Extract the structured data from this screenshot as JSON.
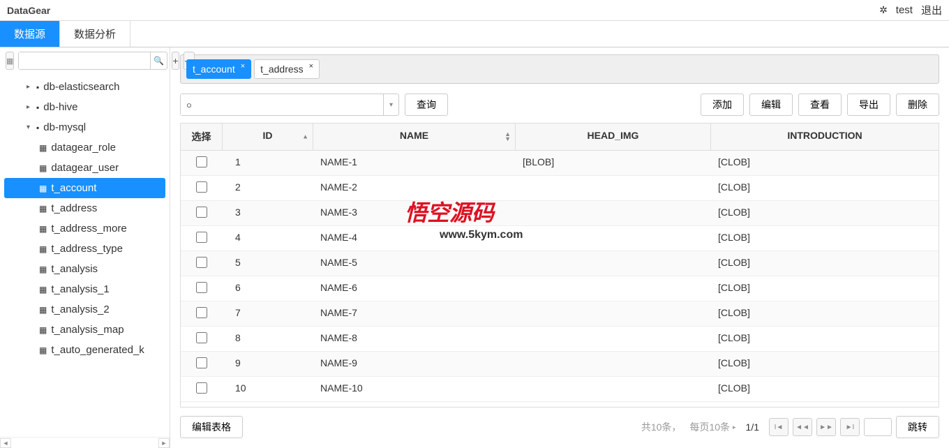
{
  "app": {
    "title": "DataGear"
  },
  "header": {
    "user": "test",
    "logout": "退出"
  },
  "mainTabs": {
    "dataSource": "数据源",
    "dataAnalysis": "数据分析"
  },
  "tree": {
    "nodes": [
      {
        "label": "db-elasticsearch",
        "expanded": false
      },
      {
        "label": "db-hive",
        "expanded": false
      },
      {
        "label": "db-mysql",
        "expanded": true
      }
    ],
    "mysqlChildren": [
      "datagear_role",
      "datagear_user",
      "t_account",
      "t_address",
      "t_address_more",
      "t_address_type",
      "t_analysis",
      "t_analysis_1",
      "t_analysis_2",
      "t_analysis_map",
      "t_auto_generated_k"
    ],
    "selected": "t_account"
  },
  "contentTabs": [
    {
      "label": "t_account",
      "active": true
    },
    {
      "label": "t_address",
      "active": false
    }
  ],
  "query": {
    "condValue": "",
    "queryBtn": "查询"
  },
  "actions": {
    "add": "添加",
    "edit": "编辑",
    "view": "查看",
    "export": "导出",
    "delete": "删除"
  },
  "columns": {
    "select": "选择",
    "id": "ID",
    "name": "NAME",
    "headImg": "HEAD_IMG",
    "intro": "INTRODUCTION"
  },
  "rows": [
    {
      "id": "1",
      "name": "NAME-1",
      "head": "[BLOB]",
      "intro": "[CLOB]"
    },
    {
      "id": "2",
      "name": "NAME-2",
      "head": "",
      "intro": "[CLOB]"
    },
    {
      "id": "3",
      "name": "NAME-3",
      "head": "",
      "intro": "[CLOB]"
    },
    {
      "id": "4",
      "name": "NAME-4",
      "head": "",
      "intro": "[CLOB]"
    },
    {
      "id": "5",
      "name": "NAME-5",
      "head": "",
      "intro": "[CLOB]"
    },
    {
      "id": "6",
      "name": "NAME-6",
      "head": "",
      "intro": "[CLOB]"
    },
    {
      "id": "7",
      "name": "NAME-7",
      "head": "",
      "intro": "[CLOB]"
    },
    {
      "id": "8",
      "name": "NAME-8",
      "head": "",
      "intro": "[CLOB]"
    },
    {
      "id": "9",
      "name": "NAME-9",
      "head": "",
      "intro": "[CLOB]"
    },
    {
      "id": "10",
      "name": "NAME-10",
      "head": "",
      "intro": "[CLOB]"
    }
  ],
  "footer": {
    "editGrid": "编辑表格",
    "total": "共10条，",
    "pageSize": "每页10条",
    "pageNum": "1/1",
    "go": "跳转"
  },
  "watermark": {
    "text": "悟空源码",
    "url": "www.5kym.com"
  }
}
